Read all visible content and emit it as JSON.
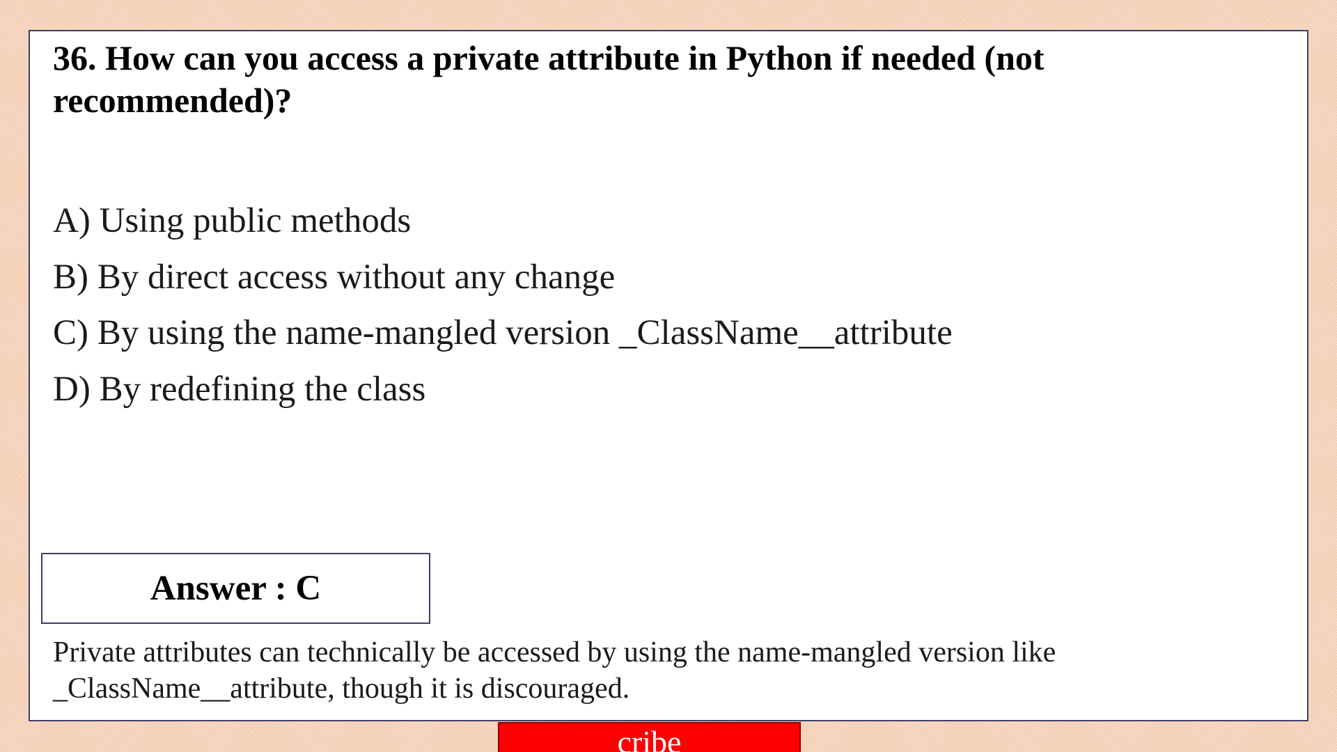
{
  "question": {
    "text": "36. How can you access a private attribute in Python if needed (not recommended)?"
  },
  "options": [
    {
      "text": "A) Using public methods"
    },
    {
      "text": "B) By direct access without any change"
    },
    {
      "text": "C) By using the name-mangled version _ClassName__attribute"
    },
    {
      "text": "D) By redefining the class"
    }
  ],
  "answer": {
    "text": "Answer : C"
  },
  "explanation": {
    "text": "Private attributes can technically be accessed by using the name-mangled version like _ClassName__attribute, though it is discouraged."
  },
  "subscribe_banner": {
    "text": "cribe",
    "background_color": "#ff0000"
  },
  "colors": {
    "page_background": "#f3c9ad",
    "card_background": "#ffffff",
    "border": "#3b3f63"
  }
}
